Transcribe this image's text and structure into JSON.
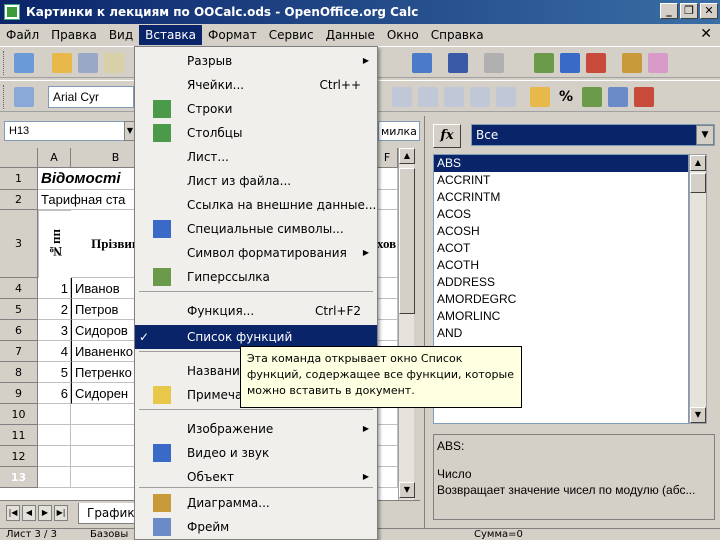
{
  "window": {
    "title": "Картинки к лекциям по OOCalc.ods - OpenOffice.org Calc"
  },
  "menubar": {
    "items": [
      "Файл",
      "Правка",
      "Вид",
      "Вставка",
      "Формат",
      "Сервис",
      "Данные",
      "Окно",
      "Справка"
    ],
    "active_index": 3
  },
  "toolbar": {
    "font_name": "Arial Cyr"
  },
  "formula": {
    "name_box": "H13",
    "content_fragment": "милка"
  },
  "sheet": {
    "columns": [
      "A",
      "B",
      "F"
    ],
    "rows": [
      {
        "num": "1",
        "b": "Відомості"
      },
      {
        "num": "2",
        "b": "Тарифная ста"
      },
      {
        "num": "3",
        "a": "№пп",
        "b": "Прізвищ",
        "f": "хов"
      },
      {
        "num": "4",
        "a": "1",
        "b": "Иванов"
      },
      {
        "num": "5",
        "a": "2",
        "b": "Петров"
      },
      {
        "num": "6",
        "a": "3",
        "b": "Сидоров"
      },
      {
        "num": "7",
        "a": "4",
        "b": "Иваненко"
      },
      {
        "num": "8",
        "a": "5",
        "b": "Петренко"
      },
      {
        "num": "9",
        "a": "6",
        "b": "Сидорен"
      },
      {
        "num": "10"
      },
      {
        "num": "11"
      },
      {
        "num": "12"
      },
      {
        "num": "13"
      }
    ],
    "tab_name": "Графики"
  },
  "statusbar": {
    "sheet": "Лист 3 / 3",
    "style": "Базовы",
    "sum": "Сумма=0"
  },
  "insert_menu": {
    "items": [
      {
        "label": "Разрыв",
        "submenu": true
      },
      {
        "label": "Ячейки...",
        "shortcut": "Ctrl++"
      },
      {
        "label": "Строки",
        "icon": "rows-icon"
      },
      {
        "label": "Столбцы",
        "icon": "columns-icon"
      },
      {
        "label": "Лист..."
      },
      {
        "label": "Лист из файла..."
      },
      {
        "label": "Ссылка на внешние данные..."
      },
      {
        "label": "Специальные символы...",
        "icon": "special-characters-icon"
      },
      {
        "label": "Символ форматирования",
        "submenu": true
      },
      {
        "label": "Гиперссылка",
        "icon": "hyperlink-icon"
      },
      {
        "label": "Функция...",
        "shortcut": "Ctrl+F2"
      },
      {
        "label": "Список функций",
        "checked": true
      },
      {
        "label": "Названия"
      },
      {
        "label": "Примечан",
        "icon": "note-icon"
      },
      {
        "label": "Изображение",
        "submenu": true
      },
      {
        "label": "Видео и звук",
        "icon": "video-sound-icon"
      },
      {
        "label": "Объект",
        "submenu": true
      },
      {
        "label": "Диаграмма...",
        "icon": "chart-icon"
      },
      {
        "label": "Фрейм",
        "icon": "frame-icon"
      }
    ]
  },
  "tooltip": {
    "lines": [
      "Эта команда открывает окно Список",
      "функций, содержащее все функции, которые",
      "можно вставить в документ."
    ]
  },
  "function_panel": {
    "fx_label": "fx",
    "category": "Все",
    "functions": [
      "ABS",
      "ACCRINT",
      "ACCRINTM",
      "ACOS",
      "ACOSH",
      "ACOT",
      "ACOTH",
      "ADDRESS",
      "AMORDEGRC",
      "AMORLINC",
      "AND",
      "",
      "",
      "",
      "ASINH"
    ],
    "selected": "ABS",
    "description": {
      "name": "ABS:",
      "param": "Число",
      "text": "Возвращает значение чисел по модулю (абс..."
    }
  },
  "colors": {
    "accent": "#0a246a",
    "menu_bg": "#f0efec",
    "tooltip_bg": "#ffffe1"
  }
}
